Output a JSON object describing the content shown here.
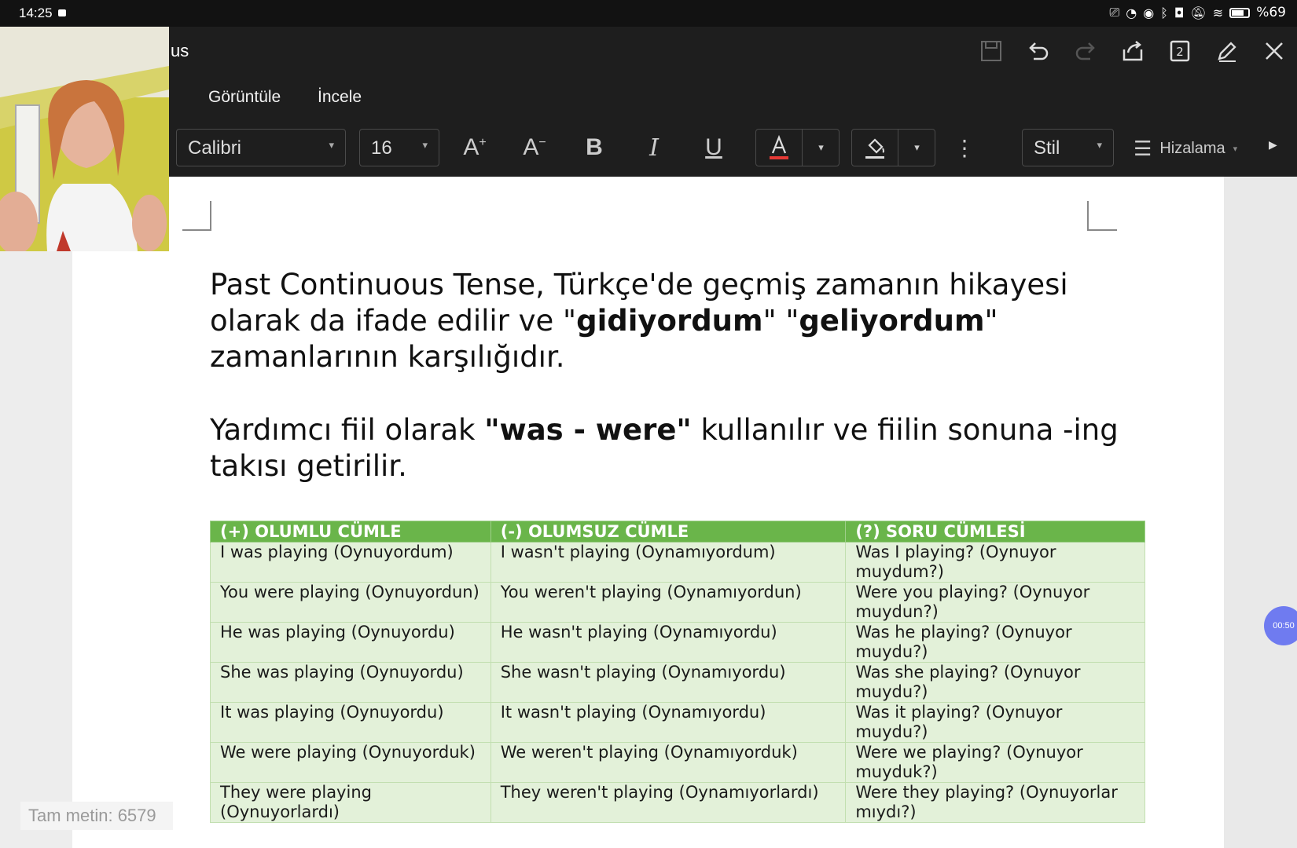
{
  "status_bar": {
    "time": "14:25",
    "battery_text": "%69"
  },
  "title_bar": {
    "title": "us"
  },
  "toolbar_top": {
    "page_count": "2"
  },
  "menu": {
    "items": [
      "Görüntüle",
      "İncele"
    ]
  },
  "format_toolbar": {
    "font_name": "Calibri",
    "font_size": "16",
    "style_label": "Stil",
    "align_label": "Hizalama",
    "font_color": "#e53935"
  },
  "document": {
    "para1": {
      "part1": "Past Continuous Tense, Türkçe'de geçmiş zamanın hikayesi olarak da ifade edilir ve \"",
      "bold1": "gidiyordum",
      "part2": "\" \"",
      "bold2": "geliyordum",
      "part3": "\" zamanlarının karşılığıdır."
    },
    "para2": {
      "part1": "Yardımcı fiil olarak ",
      "bold1": "\"was - were\"",
      "part2": " kullanılır ve fiilin sonuna -ing takısı getirilir."
    },
    "table": {
      "headers": [
        "(+) OLUMLU CÜMLE",
        "(-) OLUMSUZ CÜMLE",
        " (?) SORU CÜMLESİ"
      ],
      "rows": [
        [
          "I was playing (Oynuyordum)",
          " I wasn't playing (Oynamıyordum)",
          "Was I playing? (Oynuyor muydum?)"
        ],
        [
          "You were playing (Oynuyordun)",
          " You weren't playing (Oynamıyordun)",
          "Were you playing? (Oynuyor muydun?)"
        ],
        [
          "He was playing (Oynuyordu)",
          "He wasn't playing (Oynamıyordu)",
          "Was he playing? (Oynuyor muydu?)"
        ],
        [
          "She was playing (Oynuyordu)",
          "She wasn't playing (Oynamıyordu)",
          "Was she playing? (Oynuyor muydu?)"
        ],
        [
          "It was playing (Oynuyordu)",
          " It wasn't playing (Oynamıyordu)",
          "Was it playing? (Oynuyor muydu?)"
        ],
        [
          "We were playing (Oynuyorduk)",
          " We weren't playing (Oynamıyorduk)",
          "Were we playing? (Oynuyor muyduk?)"
        ],
        [
          "They were playing (Oynuyorlardı)",
          "They weren't playing  (Oynamıyorlardı)",
          "Were they playing? (Oynuyorlar mıydı?)"
        ]
      ]
    }
  },
  "word_count": "Tam metin: 6579",
  "timer_bubble": "00:50"
}
